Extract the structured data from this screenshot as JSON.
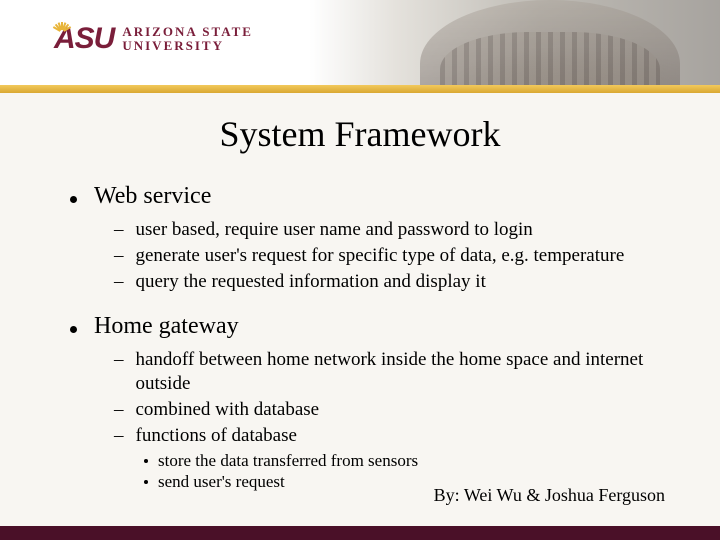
{
  "logo": {
    "mark": "ASU",
    "line1": "ARIZONA STATE",
    "line2": "UNIVERSITY"
  },
  "title": "System Framework",
  "sections": [
    {
      "heading": "Web service",
      "items": [
        "user based, require user name and password to login",
        "generate user's request for specific type of data, e.g. temperature",
        "query the requested information and display it"
      ],
      "subitems": []
    },
    {
      "heading": "Home gateway",
      "items": [
        "handoff between home network inside the home space and internet outside",
        "combined with database",
        "functions of database"
      ],
      "subitems": [
        "store the data transferred from sensors",
        "send user's request"
      ]
    }
  ],
  "byline": "By: Wei Wu & Joshua Ferguson"
}
